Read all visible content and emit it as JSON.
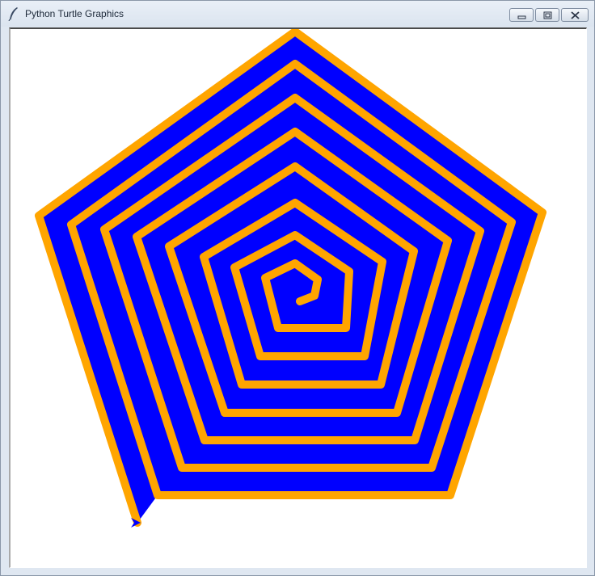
{
  "window": {
    "title": "Python Turtle Graphics",
    "controls": {
      "minimize_icon": "minimize-icon",
      "maximize_icon": "maximize-icon",
      "close_icon": "close-icon"
    }
  },
  "canvas": {
    "background_color": "#ffffff",
    "shape": "pentagon spiral",
    "pen_color": "#ffa500",
    "fill_color": "#0000ff",
    "turtle_color": "#0000ff",
    "turtle_icon": "turtle-arrow-icon"
  }
}
